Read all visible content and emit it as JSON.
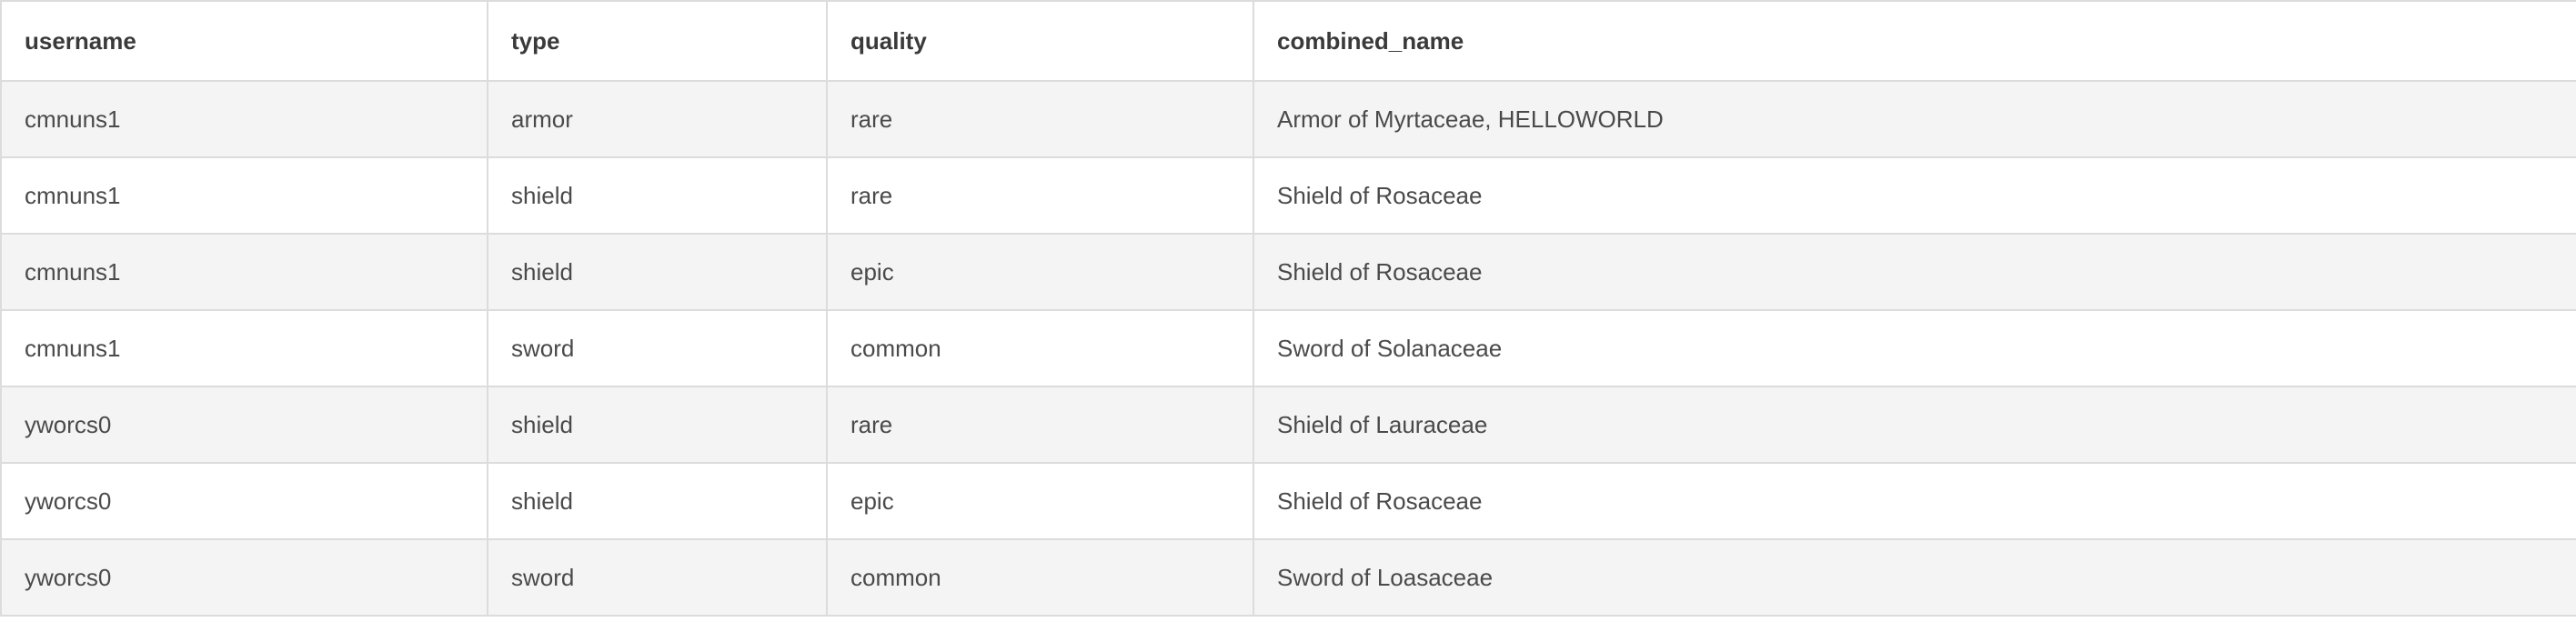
{
  "table": {
    "headers": [
      "username",
      "type",
      "quality",
      "combined_name"
    ],
    "rows": [
      [
        "cmnuns1",
        "armor",
        "rare",
        "Armor of Myrtaceae, HELLOWORLD"
      ],
      [
        "cmnuns1",
        "shield",
        "rare",
        "Shield of Rosaceae"
      ],
      [
        "cmnuns1",
        "shield",
        "epic",
        "Shield of Rosaceae"
      ],
      [
        "cmnuns1",
        "sword",
        "common",
        "Sword of Solanaceae"
      ],
      [
        "yworcs0",
        "shield",
        "rare",
        "Shield of Lauraceae"
      ],
      [
        "yworcs0",
        "shield",
        "epic",
        "Shield of Rosaceae"
      ],
      [
        "yworcs0",
        "sword",
        "common",
        "Sword of Loasaceae"
      ]
    ]
  }
}
